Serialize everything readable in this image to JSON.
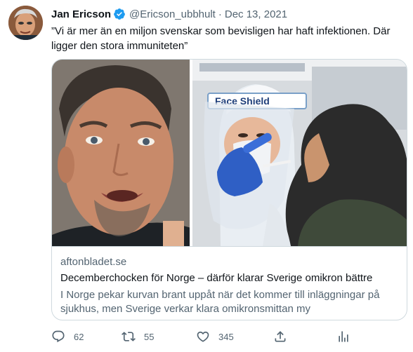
{
  "author": {
    "display_name": "Jan Ericson",
    "handle": "@Ericson_ubbhult",
    "separator": "·",
    "date": "Dec 13, 2021"
  },
  "tweet": {
    "text": "”Vi är mer än en miljon svenskar som bevisligen har haft infektionen. Där ligger den stora immuniteten”"
  },
  "card": {
    "shield_text_1": "Face Shield",
    "domain": "aftonbladet.se",
    "title": "Decemberchocken för Norge – därför klarar Sverige omikron bättre",
    "description": "I Norge pekar kurvan brant uppåt när det kommer till inläggningar på sjukhus, men Sverige verkar klara omikronsmittan my"
  },
  "actions": {
    "reply_count": "62",
    "retweet_count": "55",
    "like_count": "345"
  },
  "colors": {
    "verified": "#1d9bf0",
    "secondary_text": "#536471",
    "border": "#cfd9de"
  }
}
